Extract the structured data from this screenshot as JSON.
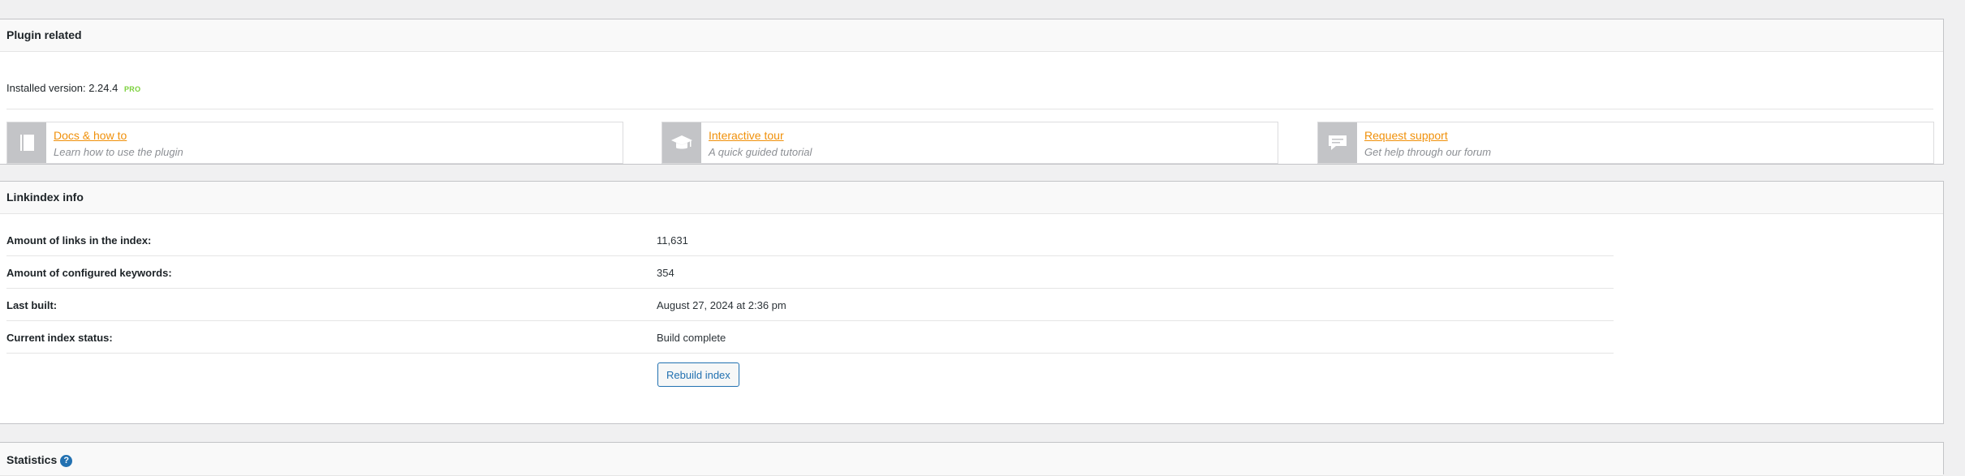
{
  "plugin": {
    "header": "Plugin related",
    "installed_label": "Installed version:",
    "version": "2.24.4",
    "badge": "PRO",
    "cards": [
      {
        "title": "Docs & how to",
        "subtitle": "Learn how to use the plugin",
        "icon": "book-icon"
      },
      {
        "title": "Interactive tour",
        "subtitle": "A quick guided tutorial",
        "icon": "graduation-cap-icon"
      },
      {
        "title": "Request support",
        "subtitle": "Get help through our forum",
        "icon": "chat-bubble-icon"
      }
    ]
  },
  "linkindex": {
    "header": "Linkindex info",
    "rows": [
      {
        "label": "Amount of links in the index:",
        "value": "11,631"
      },
      {
        "label": "Amount of configured keywords:",
        "value": "354"
      },
      {
        "label": "Last built:",
        "value": "August 27, 2024 at 2:36 pm"
      },
      {
        "label": "Current index status:",
        "value": "Build complete"
      }
    ],
    "rebuild_label": "Rebuild index"
  },
  "statistics": {
    "header": "Statistics",
    "help_glyph": "?"
  },
  "colors": {
    "link": "#f0900a",
    "primary": "#2271b1",
    "pro": "#7ad03a"
  }
}
